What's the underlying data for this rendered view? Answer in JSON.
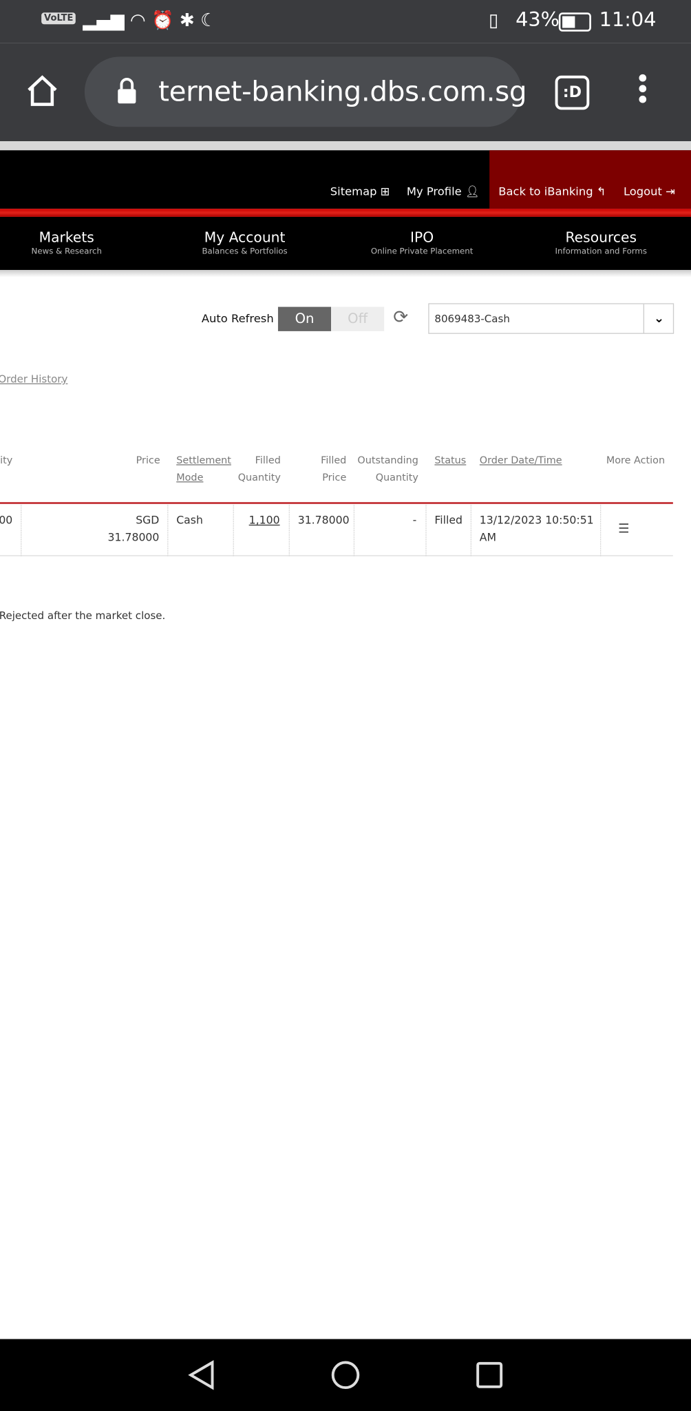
{
  "status_bar": {
    "volte": "VoLTE",
    "battery": "43%",
    "time": "11:04"
  },
  "browser": {
    "url": "ternet-banking.dbs.com.sg",
    "tab_icon": ":D"
  },
  "header": {
    "links": [
      {
        "label": "Sitemap",
        "icon": "sitemap-icon"
      },
      {
        "label": "My Profile",
        "icon": "user-icon"
      },
      {
        "label": "Back to iBanking",
        "icon": "reply-icon"
      },
      {
        "label": "Logout",
        "icon": "logout-icon"
      }
    ]
  },
  "nav": [
    {
      "title": "Markets",
      "subtitle": "News & Research"
    },
    {
      "title": "My Account",
      "subtitle": "Balances & Portfolios"
    },
    {
      "title": "IPO",
      "subtitle": "Online Private Placement"
    },
    {
      "title": "Resources",
      "subtitle": "Information and Forms"
    }
  ],
  "controls": {
    "auto_refresh_label": "Auto Refresh",
    "on": "On",
    "off": "Off",
    "account": "8069483-Cash"
  },
  "order_history_link": "Order History",
  "table": {
    "headers": {
      "quantity": "tity",
      "price": "Price",
      "settlement1": "Settlement",
      "settlement2": "Mode",
      "filled_qty1": "Filled",
      "filled_qty2": "Quantity",
      "filled_price1": "Filled",
      "filled_price2": "Price",
      "outstanding1": "Outstanding",
      "outstanding2": "Quantity",
      "status": "Status",
      "order_date": "Order Date/Time",
      "more_action": "More Action"
    },
    "row": {
      "quantity": "00",
      "price1": "SGD",
      "price2": "31.78000",
      "settlement": "Cash",
      "filled_qty": "1,100",
      "filled_price": "31.78000",
      "outstanding": "-",
      "status": "Filled",
      "date1": "13/12/2023 10:50:51",
      "date2": "AM"
    }
  },
  "note": "Rejected after the market close.",
  "colors": {
    "header_red": "#7d0000",
    "accent_red": "#e2231a"
  }
}
